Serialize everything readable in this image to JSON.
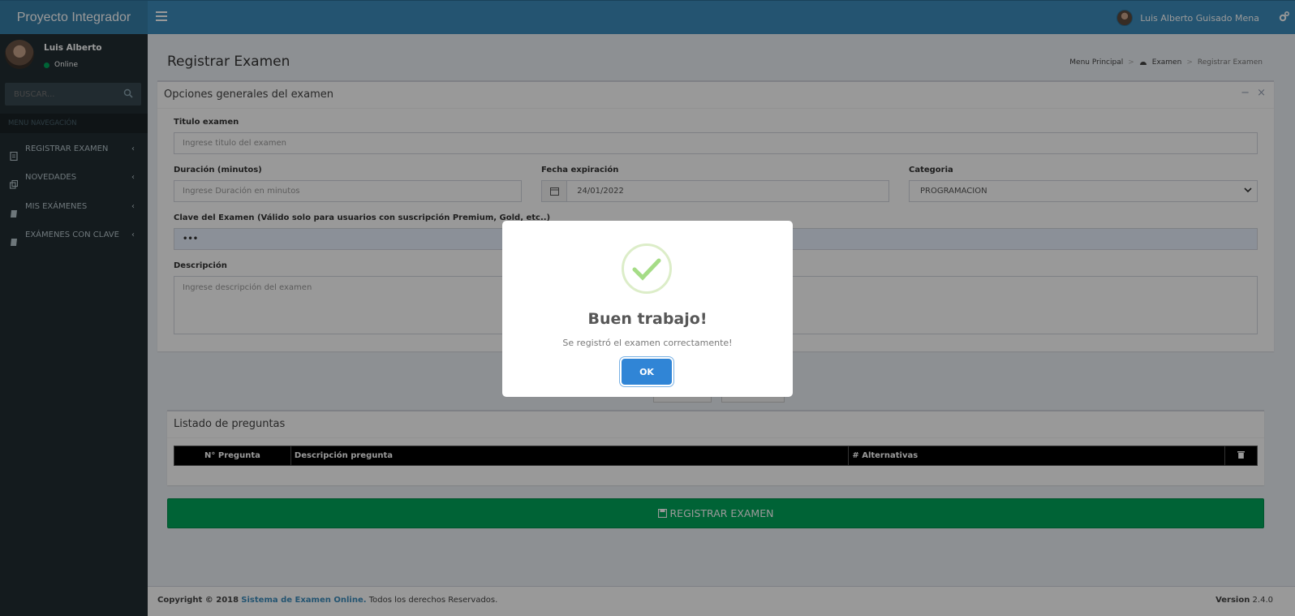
{
  "app": {
    "title": "Proyecto Integrador"
  },
  "header": {
    "user_name": "Luis Alberto Guisado Mena",
    "toggle_icon": "bars-icon",
    "settings_icon": "gears-icon"
  },
  "sidebar": {
    "user_name": "Luis Alberto",
    "status": "Online",
    "search_placeholder": "BUSCAR...",
    "menu_header": "MENU NAVEGACIÓN",
    "items": [
      {
        "label": "REGISTRAR EXAMEN",
        "icon": "file-icon"
      },
      {
        "label": "NOVEDADES",
        "icon": "clone-icon"
      },
      {
        "label": "MIS EXÁMENES",
        "icon": "book-icon"
      },
      {
        "label": "EXÁMENES CON CLAVE",
        "icon": "book-icon"
      }
    ]
  },
  "page": {
    "title": "Registrar Examen",
    "breadcrumb": [
      "Menu Principal",
      "Examen",
      "Registrar Examen"
    ]
  },
  "form": {
    "box_title": "Opciones generales del examen",
    "titulo_label": "Titulo examen",
    "titulo_placeholder": "Ingrese titulo del examen",
    "duracion_label": "Duración (minutos)",
    "duracion_placeholder": "Ingrese Duración en minutos",
    "fecha_label": "Fecha expiración",
    "fecha_value": "24/01/2022",
    "categoria_label": "Categoria",
    "categoria_value": "PROGRAMACION",
    "clave_label": "Clave del Examen (Válido solo para usuarios con suscripción Premium, Gold, etc..)",
    "clave_value": "•••",
    "descripcion_label": "Descripción",
    "descripcion_placeholder": "Ingrese descripción del examen"
  },
  "questions": {
    "box_title": "Listado de preguntas",
    "columns": [
      "N° Pregunta",
      "Descripción pregunta",
      "# Alternativas"
    ],
    "rows": []
  },
  "submit_label": "REGISTRAR EXAMEN",
  "footer": {
    "copyright": "Copyright © 2018",
    "link": "Sistema de Examen Online.",
    "rights": "Todos los derechos Reservados.",
    "version_label": "Version",
    "version": "2.4.0"
  },
  "modal": {
    "title": "Buen trabajo!",
    "message": "Se registró el examen correctamente!",
    "ok_label": "OK"
  },
  "colors": {
    "primary": "#3c8dbc",
    "sidebar": "#222d32",
    "success": "#00a65a",
    "ok_button": "#3085d6"
  }
}
